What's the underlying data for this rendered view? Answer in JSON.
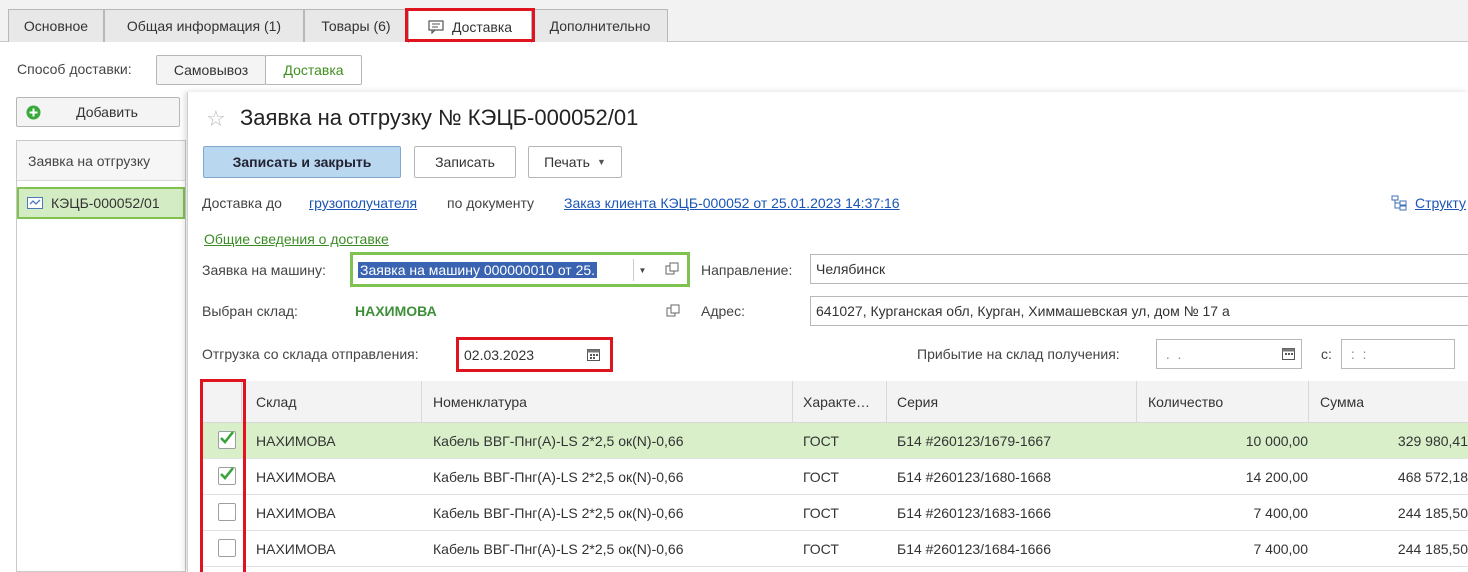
{
  "tabs": [
    {
      "label": "Основное"
    },
    {
      "label": "Общая информация (1)"
    },
    {
      "label": "Товары (6)"
    },
    {
      "label": "Доставка"
    },
    {
      "label": "Дополнительно"
    }
  ],
  "delivery_mode": {
    "label": "Способ доставки:",
    "options": [
      "Самовывоз",
      "Доставка"
    ]
  },
  "left_panel": {
    "add_label": "Добавить",
    "column": "Заявка на отгрузку",
    "item": "КЭЦБ-000052/01"
  },
  "form": {
    "title": "Заявка на отгрузку № КЭЦБ-000052/01",
    "buttons": {
      "save_close": "Записать и закрыть",
      "save": "Записать",
      "print": "Печать"
    },
    "delivery_to_label": "Доставка до",
    "delivery_to_link": "грузополучателя",
    "by_document_label": "по документу",
    "document_link": "Заказ клиента КЭЦБ-000052 от 25.01.2023 14:37:16",
    "structure_link": "Структу",
    "general_info_link": "Общие сведения о доставке",
    "vehicle_request_label": "Заявка на машину:",
    "vehicle_request_value": "Заявка на машину 000000010 от 25.",
    "direction_label": "Направление:",
    "direction_value": "Челябинск",
    "warehouse_label": "Выбран склад:",
    "warehouse_value": "НАХИМОВА",
    "address_label": "Адрес:",
    "address_value": "641027, Курганская обл, Курган, Химмашевская ул, дом № 17 а",
    "ship_date_label": "Отгрузка со склада отправления:",
    "ship_date_value": "02.03.2023",
    "arrival_label": "Прибытие на склад получения:",
    "arrival_date_value": " .  .",
    "arrival_time_label": "с:",
    "arrival_time_value": " :  :"
  },
  "table": {
    "columns": [
      "Склад",
      "Номенклатура",
      "Характе…",
      "Серия",
      "Количество",
      "Сумма"
    ],
    "rows": [
      {
        "checked": true,
        "warehouse": "НАХИМОВА",
        "item": "Кабель ВВГ-Пнг(А)-LS 2*2,5 ок(N)-0,66",
        "char": "ГОСТ",
        "series": "Б14 #260123/1679-1667",
        "qty": "10 000,00",
        "sum": "329 980,41"
      },
      {
        "checked": true,
        "warehouse": "НАХИМОВА",
        "item": "Кабель ВВГ-Пнг(А)-LS 2*2,5 ок(N)-0,66",
        "char": "ГОСТ",
        "series": "Б14 #260123/1680-1668",
        "qty": "14 200,00",
        "sum": "468 572,18"
      },
      {
        "checked": false,
        "warehouse": "НАХИМОВА",
        "item": "Кабель ВВГ-Пнг(А)-LS 2*2,5 ок(N)-0,66",
        "char": "ГОСТ",
        "series": "Б14 #260123/1683-1666",
        "qty": "7 400,00",
        "sum": "244 185,50"
      },
      {
        "checked": false,
        "warehouse": "НАХИМОВА",
        "item": "Кабель ВВГ-Пнг(А)-LS 2*2,5 ок(N)-0,66",
        "char": "ГОСТ",
        "series": "Б14 #260123/1684-1666",
        "qty": "7 400,00",
        "sum": "244 185,50"
      }
    ]
  },
  "colors": {
    "accent_green": "#6bbf3a",
    "highlight_red": "#e0141e",
    "link_blue": "#1a55b5"
  }
}
